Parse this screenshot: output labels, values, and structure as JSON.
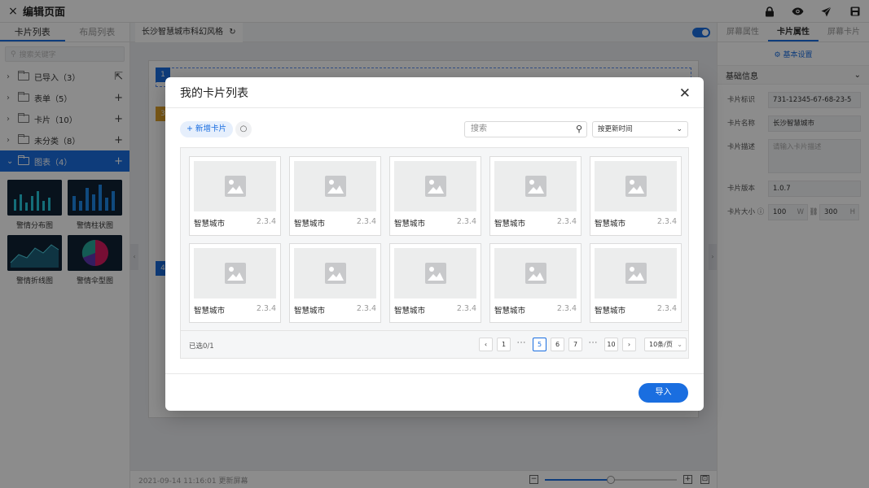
{
  "topbar": {
    "close_icon": "×",
    "title": "编辑页面",
    "icons": [
      "lock-icon",
      "eye-icon",
      "send-icon",
      "save-icon"
    ]
  },
  "left": {
    "tabs": [
      "卡片列表",
      "布局列表"
    ],
    "search_placeholder": "搜索关键字",
    "tree": [
      {
        "label": "已导入（3）",
        "tail": "⇱"
      },
      {
        "label": "表单（5）",
        "tail": "+"
      },
      {
        "label": "卡片（10）",
        "tail": "+"
      },
      {
        "label": "未分类（8）",
        "tail": "+"
      },
      {
        "label": "图表（4）",
        "tail": "+"
      }
    ],
    "thumbs": [
      "警情分布图",
      "警情柱状图",
      "警情折线图",
      "警情伞型图"
    ]
  },
  "center": {
    "tab_label": "长沙智慧城市科幻风格",
    "refresh_icon": "↻",
    "time": "2021-09-14 11:16:01 更新屏幕",
    "region_numbers": [
      "1",
      "3",
      "4"
    ],
    "zoom_fraction": 0.5
  },
  "right": {
    "tabs": [
      "屏幕属性",
      "卡片属性",
      "屏幕卡片"
    ],
    "basic_settings": "基本设置",
    "section_title": "基础信息",
    "fields": {
      "id_label": "卡片标识",
      "id_value": "731-12345-67-68-23-5",
      "name_label": "卡片名称",
      "name_value": "长沙智慧城市",
      "desc_label": "卡片描述",
      "desc_placeholder": "请输入卡片描述",
      "version_label": "卡片版本",
      "version_value": "1.0.7",
      "size_label": "卡片大小",
      "width_value": "100",
      "width_unit": "W",
      "height_value": "300",
      "height_unit": "H"
    }
  },
  "modal": {
    "title": "我的卡片列表",
    "close_icon": "✕",
    "add_label": "+ 新增卡片",
    "refresh_icon": "○",
    "search_placeholder": "搜索",
    "sort_label": "按更新时间",
    "cards": [
      {
        "name": "智慧城市",
        "version": "2.3.4"
      },
      {
        "name": "智慧城市",
        "version": "2.3.4"
      },
      {
        "name": "智慧城市",
        "version": "2.3.4"
      },
      {
        "name": "智慧城市",
        "version": "2.3.4"
      },
      {
        "name": "智慧城市",
        "version": "2.3.4"
      },
      {
        "name": "智慧城市",
        "version": "2.3.4"
      },
      {
        "name": "智慧城市",
        "version": "2.3.4"
      },
      {
        "name": "智慧城市",
        "version": "2.3.4"
      },
      {
        "name": "智慧城市",
        "version": "2.3.4"
      },
      {
        "name": "智慧城市",
        "version": "2.3.4"
      }
    ],
    "selected_text": "已选0/1",
    "pager": {
      "prev": "‹",
      "first": "1",
      "dots": "···",
      "pages": [
        "5",
        "6",
        "7"
      ],
      "last": "10",
      "next": "›",
      "per_page": "10条/页"
    },
    "import_label": "导入"
  },
  "colors": {
    "accent": "#1a6ee0",
    "overlay": "rgba(0,0,0,0.45)"
  }
}
